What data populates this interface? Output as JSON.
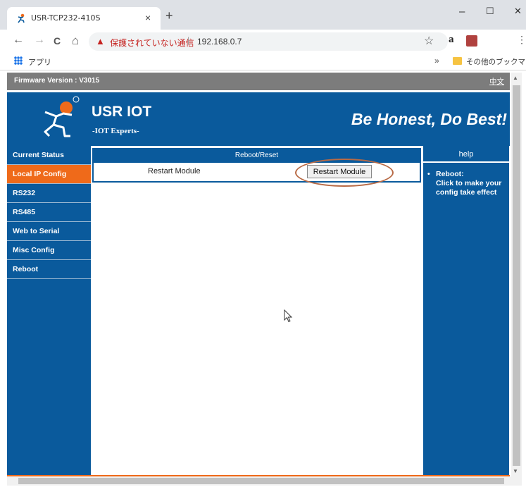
{
  "browser": {
    "tab_title": "USR-TCP232-410S",
    "tab_close": "×",
    "new_tab": "+",
    "window_controls": {
      "minimize": "–",
      "maximize": "☐",
      "close": "✕"
    },
    "nav": {
      "back": "←",
      "forward": "→",
      "reload": "C",
      "home": "⌂"
    },
    "security_warning": "保護されていない通信",
    "url": "192.168.0.7",
    "separator": "|",
    "bookmark_apps": "アプリ",
    "bookmark_more": "»",
    "bookmark_other": "その他のブックマーク",
    "icons": [
      "favicon-icon",
      "warning-icon",
      "star-icon",
      "amazon-icon",
      "pdf-icon",
      "menu-icon",
      "apps-icon",
      "folder-icon"
    ]
  },
  "page": {
    "firmware": "Firmware Version : V3015",
    "lang_link": "中文",
    "brand": "USR IOT",
    "brand_sub": "-IOT Experts-",
    "slogan": "Be Honest, Do Best!",
    "sidebar": [
      {
        "label": "Current Status"
      },
      {
        "label": "Local IP Config"
      },
      {
        "label": "RS232"
      },
      {
        "label": "RS485"
      },
      {
        "label": "Web to Serial"
      },
      {
        "label": "Misc Config"
      },
      {
        "label": "Reboot"
      }
    ],
    "active_item": "Local IP Config",
    "section_title": "Reboot/Reset",
    "row_label": "Restart Module",
    "button_label": "Restart Module",
    "help": {
      "title": "help",
      "bullet": "•",
      "item_title": "Reboot:",
      "item_text": "Click to make your config take effect"
    }
  },
  "colors": {
    "brand_blue": "#0a5a9c",
    "active_orange": "#ef6a1a",
    "annotation": "#b86a45"
  }
}
